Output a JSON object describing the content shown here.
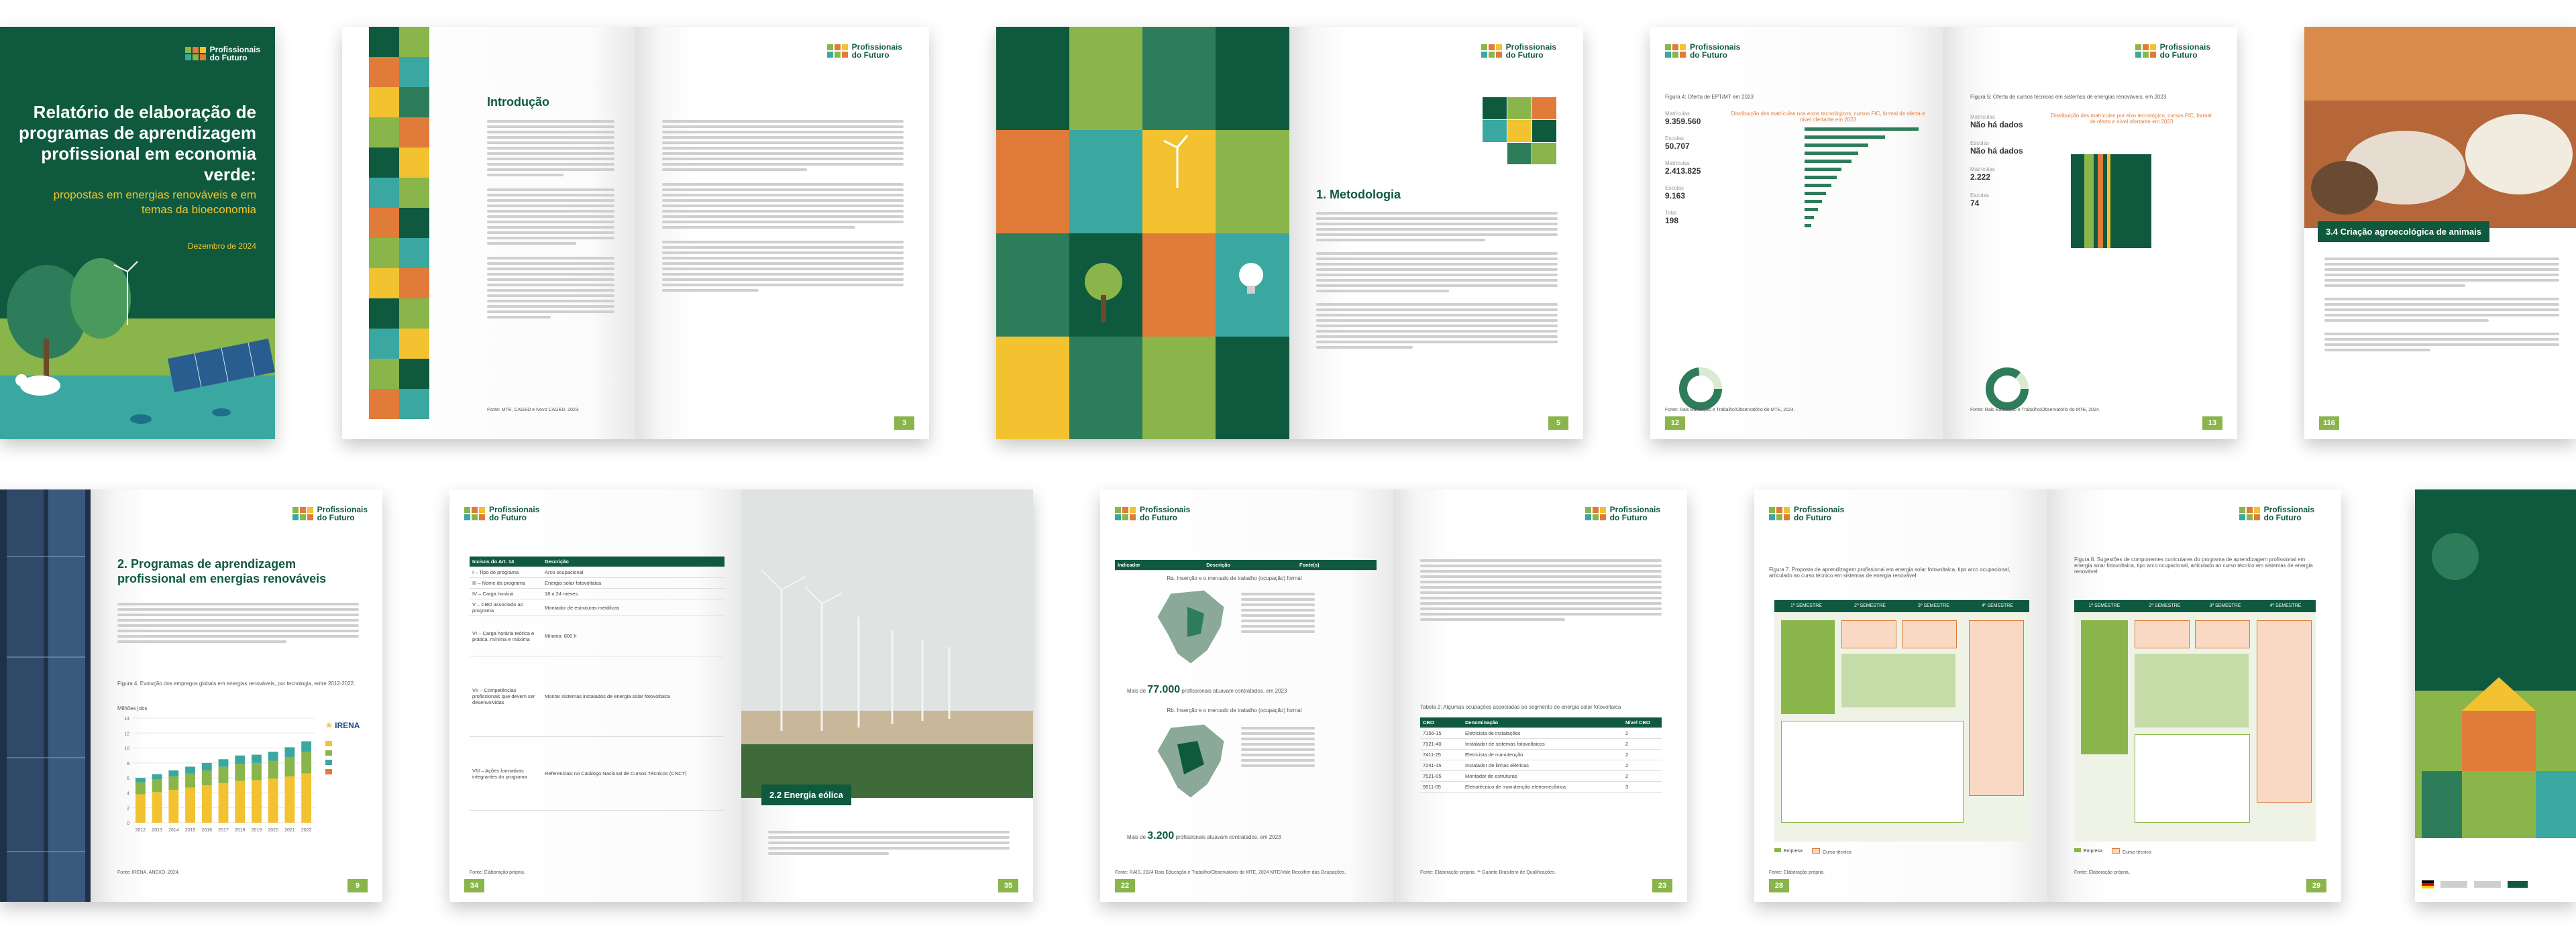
{
  "brand": {
    "logo_line1": "Profissionais",
    "logo_line2": "do Futuro"
  },
  "colors": {
    "green_dark": "#0f5a3e",
    "green_mid": "#2e7d5a",
    "green_light": "#8ab54a",
    "orange": "#e07b39",
    "yellow": "#f2c230",
    "teal": "#3aa7a0"
  },
  "cover": {
    "title": "Relatório de elaboração de programas de aprendizagem profissional em economia verde:",
    "subtitle": "propostas em energias renováveis e em temas da bioeconomia",
    "date": "Dezembro de 2024"
  },
  "spread2": {
    "heading": "Introdução",
    "footnote": "Fonte: MTE, CAGED e Novo CAGED, 2023.",
    "page_right": "3"
  },
  "spread3": {
    "heading": "1. Metodologia",
    "page_right": "5"
  },
  "spread4": {
    "fig_left": "Figura 4: Oferta de EPT/MT em 2023",
    "fig_right": "Figura 5: Oferta de cursos técnicos em sistemas de energias renováveis, em 2023",
    "chart_left_title": "Distribuição das matrículas nos eixos tecnológicos, cursos FIC, formal de oferta e nível ofertante em 2023",
    "chart_right_title": "Distribuição das matrículas por eixo tecnológico, cursos FIC, formal de oferta e nível ofertante em 2023",
    "stats_left": [
      {
        "label": "Matrículas",
        "value": "9.359.560"
      },
      {
        "label": "Escolas",
        "value": "50.707"
      },
      {
        "label": "Matrículas",
        "value": "2.413.825"
      },
      {
        "label": "Escolas",
        "value": "9.163"
      },
      {
        "label": "Total",
        "value": "198"
      }
    ],
    "stats_right": [
      {
        "label": "Matrículas",
        "value": "Não há dados"
      },
      {
        "label": "Escolas",
        "value": "Não há dados"
      },
      {
        "label": "Matrículas",
        "value": "2.222"
      },
      {
        "label": "Escolas",
        "value": "74"
      }
    ],
    "source": "Fonte: Rais Educação e Trabalho/Observatório do MTE, 2024.",
    "page_left": "12",
    "page_right": "13"
  },
  "spread5": {
    "heading": "3.4 Criação agroecológica de animais",
    "page_left": "116"
  },
  "spread6": {
    "heading": "2. Programas de aprendizagem profissional em energias renováveis",
    "fig": "Figura 4. Evolução dos empregos globais em energias renováveis, por tecnologia, entre 2012-2022.",
    "axis_label": "Milhões jobs",
    "irena": "IRENA",
    "source": "Fonte: IRENA, ANEXO, 2024.",
    "page_right": "9"
  },
  "chart_data": {
    "type": "bar",
    "categories": [
      "2012",
      "2013",
      "2014",
      "2015",
      "2016",
      "2017",
      "2018",
      "2019",
      "2020",
      "2021",
      "2022"
    ],
    "series": [
      {
        "values": [
          3.8,
          4.1,
          4.4,
          4.7,
          5.0,
          5.3,
          5.6,
          5.7,
          5.9,
          6.2,
          6.6
        ]
      },
      {
        "values": [
          1.6,
          1.7,
          1.8,
          1.9,
          2.0,
          2.2,
          2.3,
          2.3,
          2.4,
          2.6,
          2.9
        ]
      },
      {
        "values": [
          0.6,
          0.7,
          0.8,
          0.9,
          1.0,
          1.0,
          1.1,
          1.1,
          1.2,
          1.3,
          1.4
        ]
      }
    ],
    "ylim": [
      0,
      14
    ],
    "yticks": [
      "0",
      "2",
      "4",
      "6",
      "8",
      "10",
      "12",
      "14"
    ]
  },
  "spread7": {
    "table_header": [
      "Incisos do Art. 14",
      "Descrição"
    ],
    "rows": [
      "I – Tipo de programa",
      "III – Nome da programa",
      "IV – Carga horária",
      "V – CBO associado ao programa",
      "VI – Carga horária teórica e prática, mínima e máxima",
      "VII – Competências profissionais que devem ser desenvolvidas",
      "VIII – Ações formativas integrantes do programa"
    ],
    "descriptions": [
      "Arco ocupacional",
      "Energia solar fotovoltaica",
      "18 a 24 meses",
      "Montador de estruturas metálicas",
      "Mínimo: 800 h",
      "Montar sistemas instalados de energia solar fotovoltaica",
      "Referenciais no Catálogo Nacional de Cursos Técnicos (CNCT)"
    ],
    "source": "Fonte: Elaboração própria.",
    "photo_caption": "2.2 Energia eólica",
    "page_left": "34",
    "page_right": "35"
  },
  "spread8": {
    "table_header": [
      "Indicador",
      "Descrição",
      "Fonte(s)"
    ],
    "map1_title": "Ra. Inserção e o mercado de trabalho (ocupação) formal",
    "map2_title": "Rb. Inserção e o mercado de trabalho (ocupação) formal",
    "stat1": "77.000",
    "stat2": "3.200",
    "stat_prefix": "Mais de",
    "stat_suffix": "profissionais atuavam contratados, em 2023",
    "right_title": "Tabela 2: Algumas ocupações associadas ao segmento de energia solar fotovoltaica",
    "table2_header": [
      "CBO",
      "Denominação",
      "Nível CBO"
    ],
    "table2_rows": [
      [
        "7156-15",
        "Eletricista de instalações",
        "2"
      ],
      [
        "7321-40",
        "Instalador de sistemas fotovoltaicos",
        "2"
      ],
      [
        "7411-25",
        "Eletricista de manutenção",
        "2"
      ],
      [
        "7241-15",
        "Instalador de linhas elétricas",
        "2"
      ],
      [
        "7521-05",
        "Montador de estruturas",
        "2"
      ],
      [
        "9511-05",
        "Eletrotécnico de manutenção eletromecânica",
        "3"
      ]
    ],
    "source_left": "Fonte: RAIS, 2024 Rais Educação e Trabalho/Observatório do MTE, 2024 MTE/Vale Recolher das Ocupações.",
    "source_right": "Fonte: Elaboração própria. ** Guardo Brasileiro de Qualificações.",
    "page_left": "22",
    "page_right": "23"
  },
  "spread9": {
    "fig_left": "Figura 7. Proposta de aprendizagem profissional em energia solar fotovoltaica, tipo arco ocupacional, articulado ao curso técnico em sistemas de energia renovável",
    "fig_right": "Figura 8. Sugestões de componentes curriculares do programa de aprendizagem profissional em energia solar fotovoltaica, tipo arco ocupacional, articulado ao curso técnico em sistemas de energia renovável",
    "sem_labels": [
      "1º SEMESTRE",
      "2º SEMESTRE",
      "3º SEMESTRE",
      "4º SEMESTRE"
    ],
    "legend": [
      "Empresa",
      "Curso técnico"
    ],
    "source": "Fonte: Elaboração própria.",
    "page_left": "28",
    "page_right": "29"
  }
}
